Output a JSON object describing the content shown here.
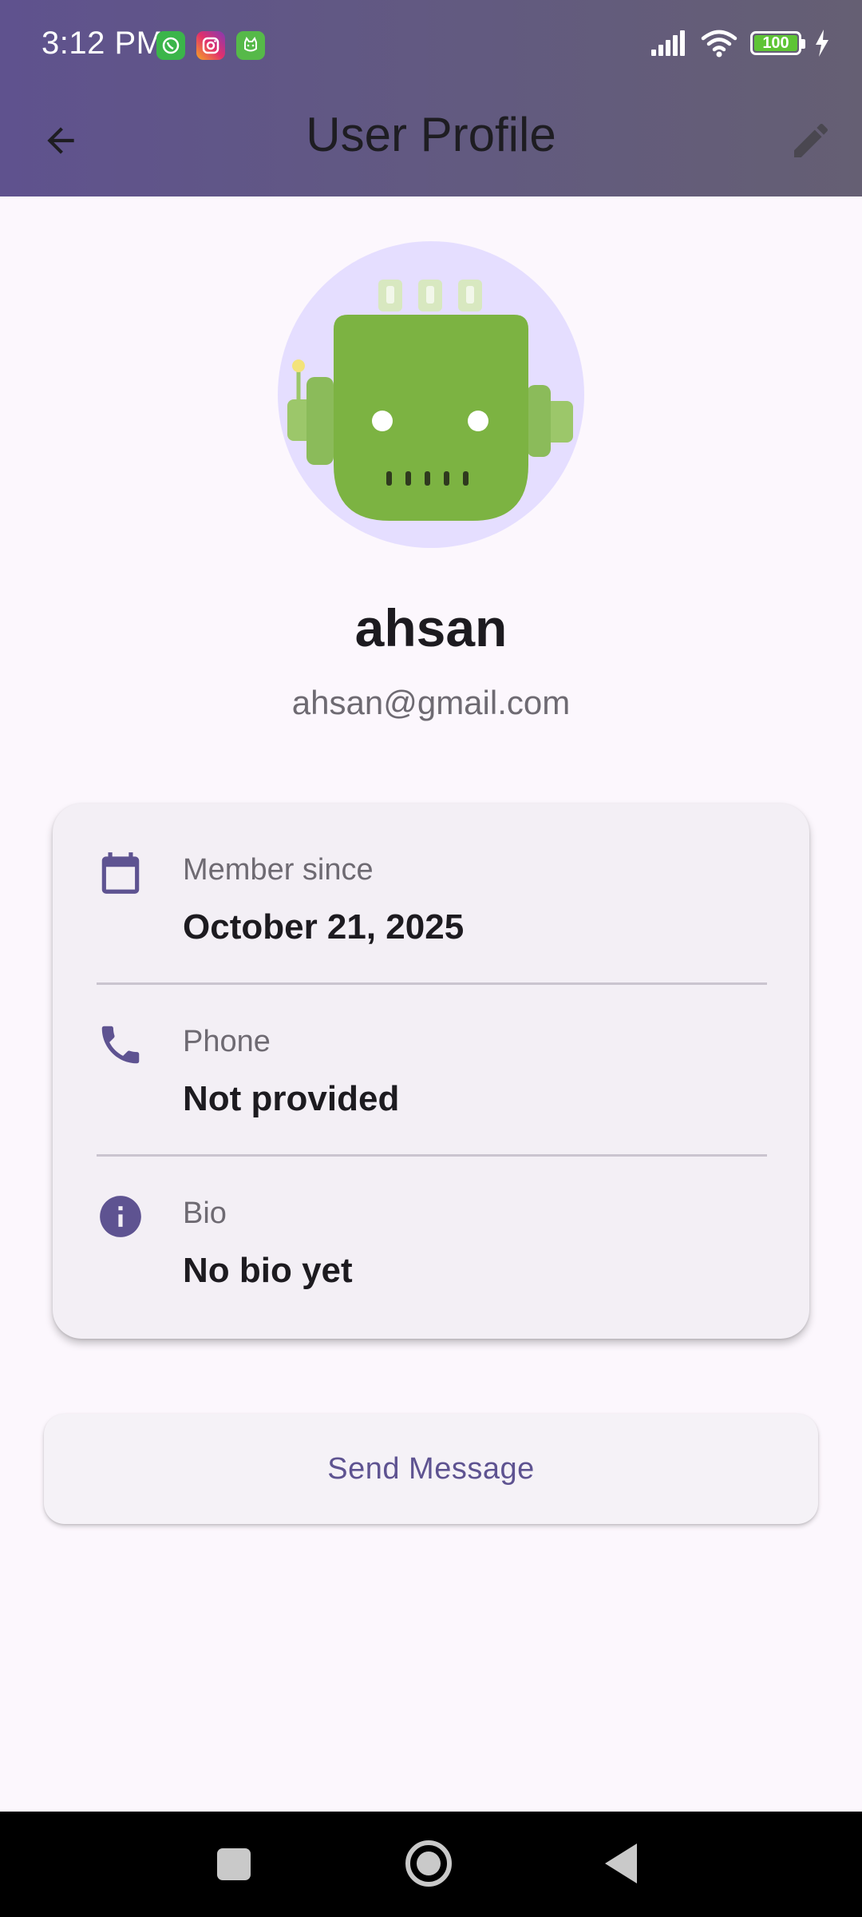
{
  "status_bar": {
    "time": "3:12 PM",
    "notification_icons": [
      "whatsapp-icon",
      "instagram-icon",
      "cat-app-icon"
    ],
    "battery_level": "100",
    "signal_icon": "signal-bars-icon",
    "wifi_icon": "wifi-icon",
    "charging_icon": "lightning-icon"
  },
  "app_bar": {
    "title": "User Profile",
    "back_icon": "arrow-back-icon",
    "edit_icon": "pencil-icon",
    "background_colors": [
      "#5F528E",
      "#655F73"
    ]
  },
  "profile": {
    "avatar_icon": "robot-avatar-icon",
    "name": "ahsan",
    "email": "ahsan@gmail.com"
  },
  "info_card": {
    "rows": [
      {
        "icon": "calendar-icon",
        "label": "Member since",
        "value": "October 21, 2025"
      },
      {
        "icon": "phone-icon",
        "label": "Phone",
        "value": "Not provided"
      },
      {
        "icon": "info-icon",
        "label": "Bio",
        "value": "No bio yet"
      }
    ]
  },
  "actions": {
    "send_message_label": "Send Message"
  },
  "nav_bar": {
    "icons": [
      "recent-apps-icon",
      "home-icon",
      "back-triangle-icon"
    ]
  },
  "colors": {
    "accent": "#5E5391",
    "background": "#FCF7FD",
    "card": "#F3EFF5",
    "avatar_bg": "#E5DEFF",
    "robot_green": "#7CB342"
  }
}
